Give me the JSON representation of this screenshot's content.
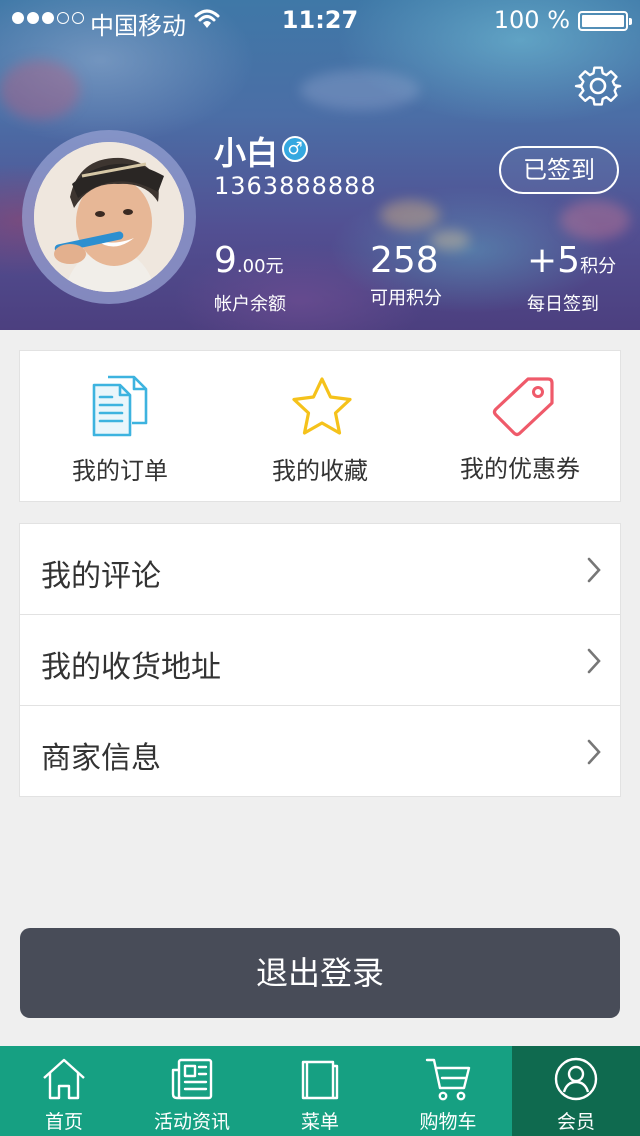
{
  "status_bar": {
    "carrier": "中国移动",
    "time": "11:27",
    "battery": "100 %"
  },
  "profile": {
    "name": "小白",
    "gender_symbol": "♂",
    "phone": "1363888888",
    "checkin_label": "已签到",
    "stats": {
      "balance_value": "9",
      "balance_decimal": ".00元",
      "balance_label": "帐户余额",
      "points_value": "258",
      "points_label": "可用积分",
      "daily_value": "+5",
      "daily_unit": "积分",
      "daily_label": "每日签到"
    }
  },
  "shortcuts": [
    {
      "label": "我的订单",
      "icon": "document-icon",
      "color": "#3db3df"
    },
    {
      "label": "我的收藏",
      "icon": "star-icon",
      "color": "#f5c21b"
    },
    {
      "label": "我的优惠券",
      "icon": "tag-icon",
      "color": "#ef5a6a"
    }
  ],
  "menu": [
    {
      "label": "我的评论"
    },
    {
      "label": "我的收货地址"
    },
    {
      "label": "商家信息"
    }
  ],
  "logout_label": "退出登录",
  "tabs": [
    {
      "label": "首页",
      "icon": "home-icon"
    },
    {
      "label": "活动资讯",
      "icon": "news-icon",
      "has_badge": true
    },
    {
      "label": "菜单",
      "icon": "book-icon"
    },
    {
      "label": "购物车",
      "icon": "cart-icon"
    },
    {
      "label": "会员",
      "icon": "user-icon",
      "active": true
    }
  ],
  "colors": {
    "tab_bar": "#16a082",
    "tab_active": "#0f6a4f",
    "logout_button": "#484c58",
    "badge": "#f2b81d"
  }
}
